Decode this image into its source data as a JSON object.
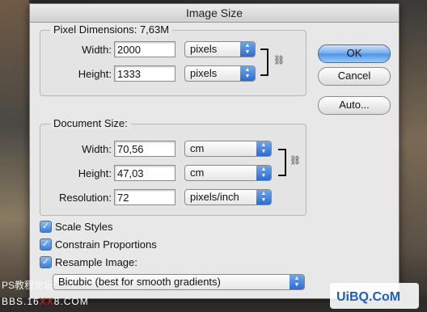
{
  "dialog": {
    "title": "Image Size"
  },
  "pixel_dimensions": {
    "title": "Pixel Dimensions:",
    "size": "7,63M",
    "width_label": "Width:",
    "width_value": "2000",
    "width_unit": "pixels",
    "height_label": "Height:",
    "height_value": "1333",
    "height_unit": "pixels"
  },
  "document_size": {
    "title": "Document Size:",
    "width_label": "Width:",
    "width_value": "70,56",
    "width_unit": "cm",
    "height_label": "Height:",
    "height_value": "47,03",
    "height_unit": "cm",
    "resolution_label": "Resolution:",
    "resolution_value": "72",
    "resolution_unit": "pixels/inch"
  },
  "buttons": {
    "ok": "OK",
    "cancel": "Cancel",
    "auto": "Auto..."
  },
  "options": {
    "scale_styles": "Scale Styles",
    "constrain_proportions": "Constrain Proportions",
    "resample_image": "Resample Image:",
    "resample_method": "Bicubic (best for smooth gradients)"
  },
  "watermark": {
    "line1": "PS教程论坛",
    "line2_a": "BBS.16",
    "line2_b": "XX",
    "line2_c": "8.COM",
    "logo_text": "UiBQ.CoM"
  },
  "colors": {
    "accent": "#3b7fd6",
    "ok_button": "#6da8ee"
  }
}
